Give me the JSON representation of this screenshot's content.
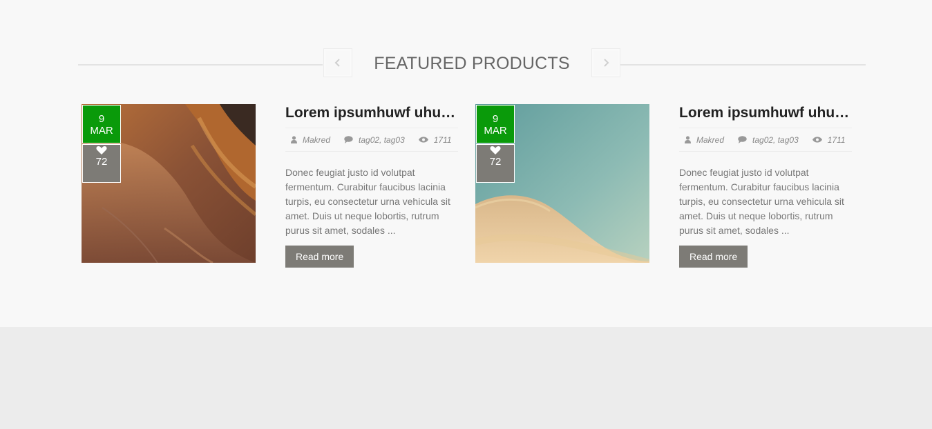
{
  "section": {
    "title": "FEATURED PRODUCTS",
    "prev_icon": "chevron-left-icon",
    "next_icon": "chevron-right-icon"
  },
  "colors": {
    "date_badge": "#0a9a0a",
    "likes_badge": "#7d7b76",
    "button": "#7d7b76"
  },
  "products": [
    {
      "date": {
        "day": "9",
        "month": "MAR"
      },
      "likes": "72",
      "title": "Lorem ipsumhuwf uhuw …",
      "author": "Makred",
      "tags": "tag02, tag03",
      "views": "1711",
      "excerpt": "Donec feugiat justo id volutpat fermentum. Curabitur faucibus lacinia turpis, eu consectetur urna vehicula sit amet. Duis ut neque lobortis, rutrum purus sit amet, sodales ...",
      "button_label": "Read more"
    },
    {
      "date": {
        "day": "9",
        "month": "MAR"
      },
      "likes": "72",
      "title": "Lorem ipsumhuwf uhuw …",
      "author": "Makred",
      "tags": "tag02, tag03",
      "views": "1711",
      "excerpt": "Donec feugiat justo id volutpat fermentum. Curabitur faucibus lacinia turpis, eu consectetur urna vehicula sit amet. Duis ut neque lobortis, rutrum purus sit amet, sodales ...",
      "button_label": "Read more"
    }
  ]
}
